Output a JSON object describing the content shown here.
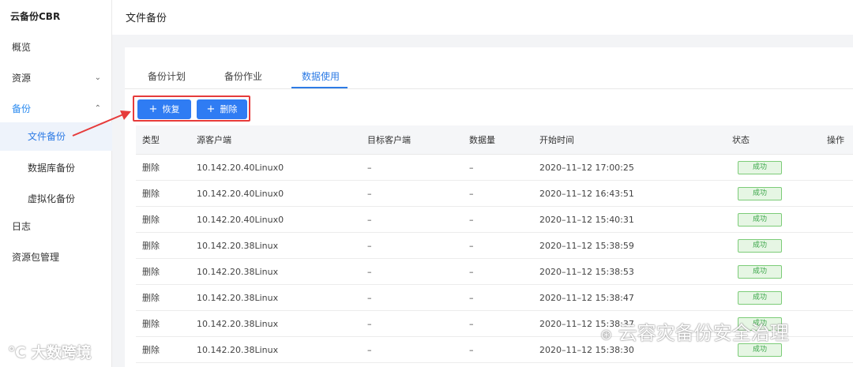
{
  "sidebar": {
    "app_title": "云备份CBR",
    "items": [
      {
        "label": "概览"
      },
      {
        "label": "资源",
        "chevron": "chevron-down-icon"
      },
      {
        "label": "备份",
        "chevron": "chevron-up-icon"
      },
      {
        "label": "文件备份"
      },
      {
        "label": "数据库备份"
      },
      {
        "label": "虚拟化备份"
      },
      {
        "label": "日志"
      },
      {
        "label": "资源包管理"
      }
    ]
  },
  "header": {
    "title": "文件备份"
  },
  "tabs": [
    {
      "label": "备份计划"
    },
    {
      "label": "备份作业"
    },
    {
      "label": "数据使用"
    }
  ],
  "toolbar": {
    "restore_label": "恢复",
    "delete_label": "删除",
    "highlight_color": "#e63b3b"
  },
  "table": {
    "columns": [
      "类型",
      "源客户端",
      "目标客户端",
      "数据量",
      "开始时间",
      "状态",
      "操作"
    ],
    "rows": [
      {
        "type": "删除",
        "source": "10.142.20.40Linux0",
        "target": "–",
        "size": "–",
        "start": "2020–11–12 17:00:25",
        "status": "成功"
      },
      {
        "type": "删除",
        "source": "10.142.20.40Linux0",
        "target": "–",
        "size": "–",
        "start": "2020–11–12 16:43:51",
        "status": "成功"
      },
      {
        "type": "删除",
        "source": "10.142.20.40Linux0",
        "target": "–",
        "size": "–",
        "start": "2020–11–12 15:40:31",
        "status": "成功"
      },
      {
        "type": "删除",
        "source": "10.142.20.38Linux",
        "target": "–",
        "size": "–",
        "start": "2020–11–12 15:38:59",
        "status": "成功"
      },
      {
        "type": "删除",
        "source": "10.142.20.38Linux",
        "target": "–",
        "size": "–",
        "start": "2020–11–12 15:38:53",
        "status": "成功"
      },
      {
        "type": "删除",
        "source": "10.142.20.38Linux",
        "target": "–",
        "size": "–",
        "start": "2020–11–12 15:38:47",
        "status": "成功"
      },
      {
        "type": "删除",
        "source": "10.142.20.38Linux",
        "target": "–",
        "size": "–",
        "start": "2020–11–12 15:38:37",
        "status": "成功"
      },
      {
        "type": "删除",
        "source": "10.142.20.38Linux",
        "target": "–",
        "size": "–",
        "start": "2020–11–12 15:38:30",
        "status": "成功"
      }
    ]
  },
  "watermarks": {
    "left": "大数跨境",
    "right": "云容灾备份安全治理"
  },
  "colors": {
    "accent": "#2d7be5",
    "button": "#2f7cf3",
    "success_text": "#3aa548",
    "success_bg": "#e6f6e4"
  }
}
